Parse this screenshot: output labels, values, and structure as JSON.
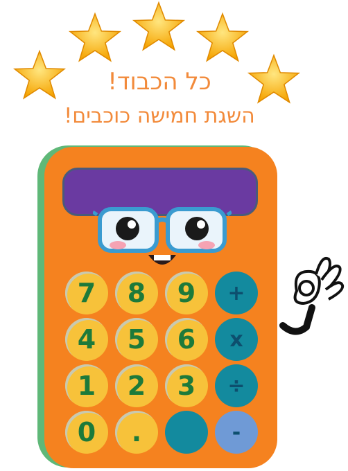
{
  "header": {
    "line1": "כל הכבוד!",
    "line2": "השגת חמישה כוכבים!"
  },
  "rating": {
    "stars": 5,
    "max": 5
  },
  "colors": {
    "star": "#f7b500",
    "title": "#f28a3a",
    "calculator_body": "#f5821f",
    "calculator_shadow": "#5fb878",
    "screen": "#6a3aa1",
    "number_key": "#f7c23a",
    "number_text": "#1d7a3a",
    "operator_key": "#138a9e",
    "minus_key": "#6f9ad6"
  },
  "calculator": {
    "keys": [
      {
        "label": "7",
        "kind": "num"
      },
      {
        "label": "8",
        "kind": "num"
      },
      {
        "label": "9",
        "kind": "num"
      },
      {
        "label": "+",
        "kind": "op"
      },
      {
        "label": "4",
        "kind": "num"
      },
      {
        "label": "5",
        "kind": "num"
      },
      {
        "label": "6",
        "kind": "num"
      },
      {
        "label": "x",
        "kind": "op"
      },
      {
        "label": "1",
        "kind": "num"
      },
      {
        "label": "2",
        "kind": "num"
      },
      {
        "label": "3",
        "kind": "num"
      },
      {
        "label": "÷",
        "kind": "op"
      },
      {
        "label": "0",
        "kind": "num"
      },
      {
        "label": ".",
        "kind": "num"
      },
      {
        "label": "",
        "kind": "op"
      },
      {
        "label": "-",
        "kind": "op2"
      }
    ]
  },
  "icons": [
    "star-icon",
    "glasses-face-icon",
    "ok-hand-icon"
  ]
}
